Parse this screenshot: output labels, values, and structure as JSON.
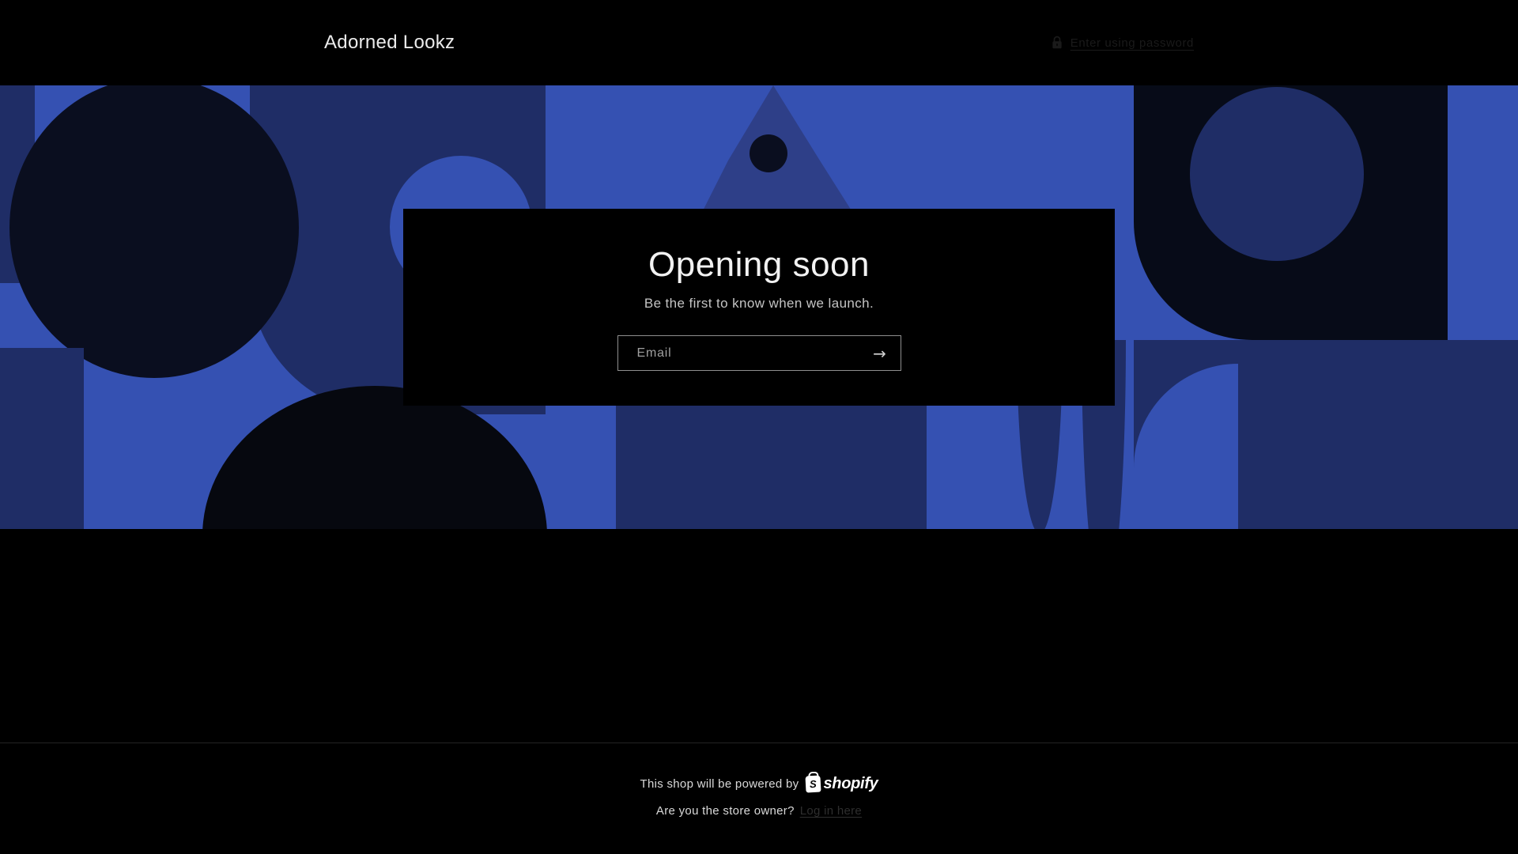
{
  "palette": {
    "page-bg": "#000000",
    "blue": "#3551b2",
    "navy": "#1f2d66",
    "navy-light": "#2e3f88",
    "dark": "#0a0e1f",
    "darker": "#06080f",
    "dark-right": "#070b18",
    "header-text": "#ebebeb",
    "muted-link": "#1a1a1a",
    "heading": "#f2f2f2",
    "subtext": "#c4c4c4",
    "placeholder": "#9f9f9f",
    "input-border": "#8f8f8f",
    "arrow": "#d0d0d0",
    "footer-text": "#d9d9d9",
    "footer-link": "#2e2e2e",
    "divider": "#232323",
    "logo-white": "#ffffff"
  },
  "header": {
    "store_name": "Adorned Lookz",
    "password_link": "Enter using password"
  },
  "hero": {
    "title": "Opening soon",
    "subtitle": "Be the first to know when we launch.",
    "email_placeholder": "Email",
    "submit_symbol": "→"
  },
  "footer": {
    "powered_by": "This shop will be powered by",
    "logo_letter": "S",
    "logo_word": "shopify",
    "owner_question": "Are you the store owner?",
    "login_link": "Log in here"
  }
}
